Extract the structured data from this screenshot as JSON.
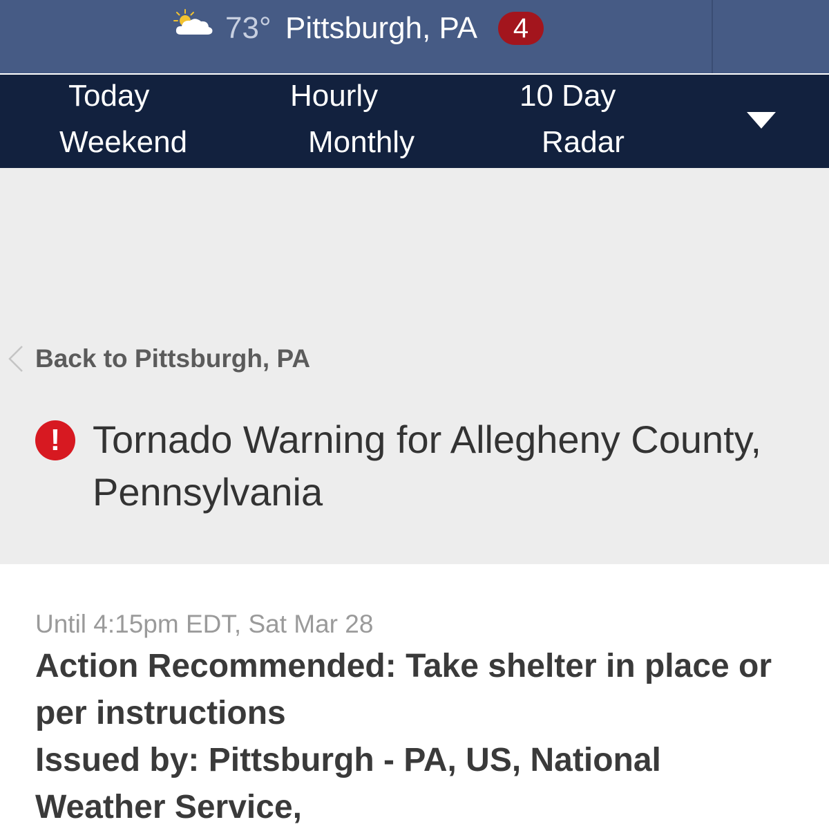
{
  "header": {
    "weather_icon": "partly-cloudy-icon",
    "temperature": "73°",
    "location": "Pittsburgh, PA",
    "alert_count": "4"
  },
  "nav": {
    "items": [
      "Today",
      "Hourly",
      "10 Day",
      "Weekend",
      "Monthly",
      "Radar"
    ],
    "more_icon": "caret-down-icon"
  },
  "alert": {
    "back_label": "Back to Pittsburgh, PA",
    "title": "Tornado Warning for Allegheny County, Pennsylvania",
    "until": "Until 4:15pm EDT, Sat Mar 28",
    "action": "Action Recommended: Take shelter in place or per instructions",
    "issued_by": "Issued by: Pittsburgh - PA, US, National Weather Service,"
  },
  "colors": {
    "header_bg": "#465b85",
    "nav_bg": "#12213e",
    "alert_badge": "#a3151d",
    "warning_icon": "#d71921"
  }
}
